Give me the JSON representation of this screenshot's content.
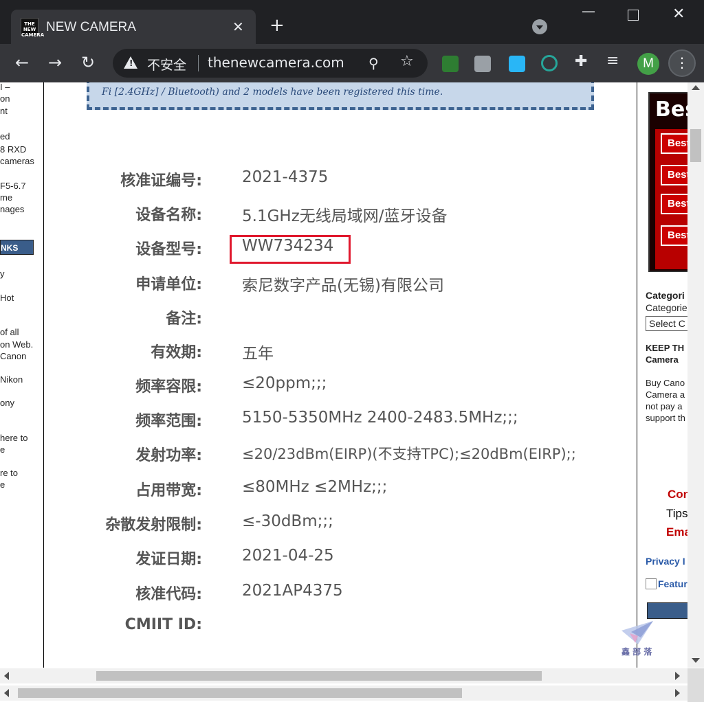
{
  "browser": {
    "tab_title": "NEW CAMERA",
    "favicon_text": "THE NEW CAMERA",
    "close_tab": "✕",
    "new_tab": "+",
    "security_label": "不安全",
    "url": "thenewcamera.com",
    "profile_initial": "M",
    "menu_icon": "⋮",
    "back_icon": "←",
    "forward_icon": "→",
    "reload_icon": "↻",
    "zoom_icon": "⚲",
    "star_icon": "☆",
    "minimize_icon": "—",
    "close_window_icon": "✕",
    "puzzle_icon": "✚",
    "queue_icon": "≡"
  },
  "left_sidebar": {
    "fragments": [
      "I –",
      "on",
      "nt",
      "ed",
      "8 RXD",
      "cameras",
      "F5-6.7",
      "me",
      "nages",
      "y",
      "Hot",
      "of all",
      "on Web.",
      "Canon",
      "Nikon",
      "ony",
      "here to",
      "e",
      "re to",
      "e"
    ],
    "links_header": "NKS"
  },
  "main": {
    "intro_text": "Fi [2.4GHz] / Bluetooth) and 2 models have been registered this time.",
    "specs": [
      {
        "label": "核准证编号:",
        "value": "2021-4375"
      },
      {
        "label": "设备名称:",
        "value": "5.1GHz无线局域网/蓝牙设备"
      },
      {
        "label": "设备型号:",
        "value": "WW734234"
      },
      {
        "label": "申请单位:",
        "value": "索尼数字产品(无锡)有限公司"
      },
      {
        "label": "备注:",
        "value": ""
      },
      {
        "label": "有效期:",
        "value": "五年"
      },
      {
        "label": "频率容限:",
        "value": "≤20ppm;;;"
      },
      {
        "label": "频率范围:",
        "value": "5150-5350MHz 2400-2483.5MHz;;;"
      },
      {
        "label": "发射功率:",
        "value": "≤20/23dBm(EIRP)(不支持TPC);≤20dBm(EIRP);;"
      },
      {
        "label": "占用带宽:",
        "value": "≤80MHz ≤2MHz;;;"
      },
      {
        "label": "杂散发射限制:",
        "value": "≤-30dBm;;;"
      },
      {
        "label": "发证日期:",
        "value": "2021-04-25"
      },
      {
        "label": "核准代码:",
        "value": "2021AP4375"
      },
      {
        "label": "CMIIT ID:",
        "value": ""
      }
    ]
  },
  "right_sidebar": {
    "ad_title": "Bes",
    "ad_buttons": [
      "Best",
      "Best",
      "Best",
      "Best"
    ],
    "categories_heading": "Categori",
    "categories_label": "Categorie",
    "select_placeholder": "Select C",
    "keep_heading_1": "KEEP TH",
    "keep_heading_2": "Camera",
    "buy_text": [
      "Buy Cano",
      "Camera a",
      "not pay a",
      "support th"
    ],
    "contact_1": "Con",
    "contact_2": "Tips",
    "contact_3": "Ema",
    "privacy": "Privacy I",
    "featured_alt": "Featur"
  },
  "watermark_text": "鑫 部 落",
  "colors": {
    "highlight_box": "#e0182d",
    "intro_box_bg": "#c7d7ea",
    "intro_box_border": "#3d6391",
    "chrome_dark": "#202124",
    "chrome_toolbar": "#35363a",
    "link_blue": "#2a5aa8",
    "contact_red": "#c00000"
  }
}
